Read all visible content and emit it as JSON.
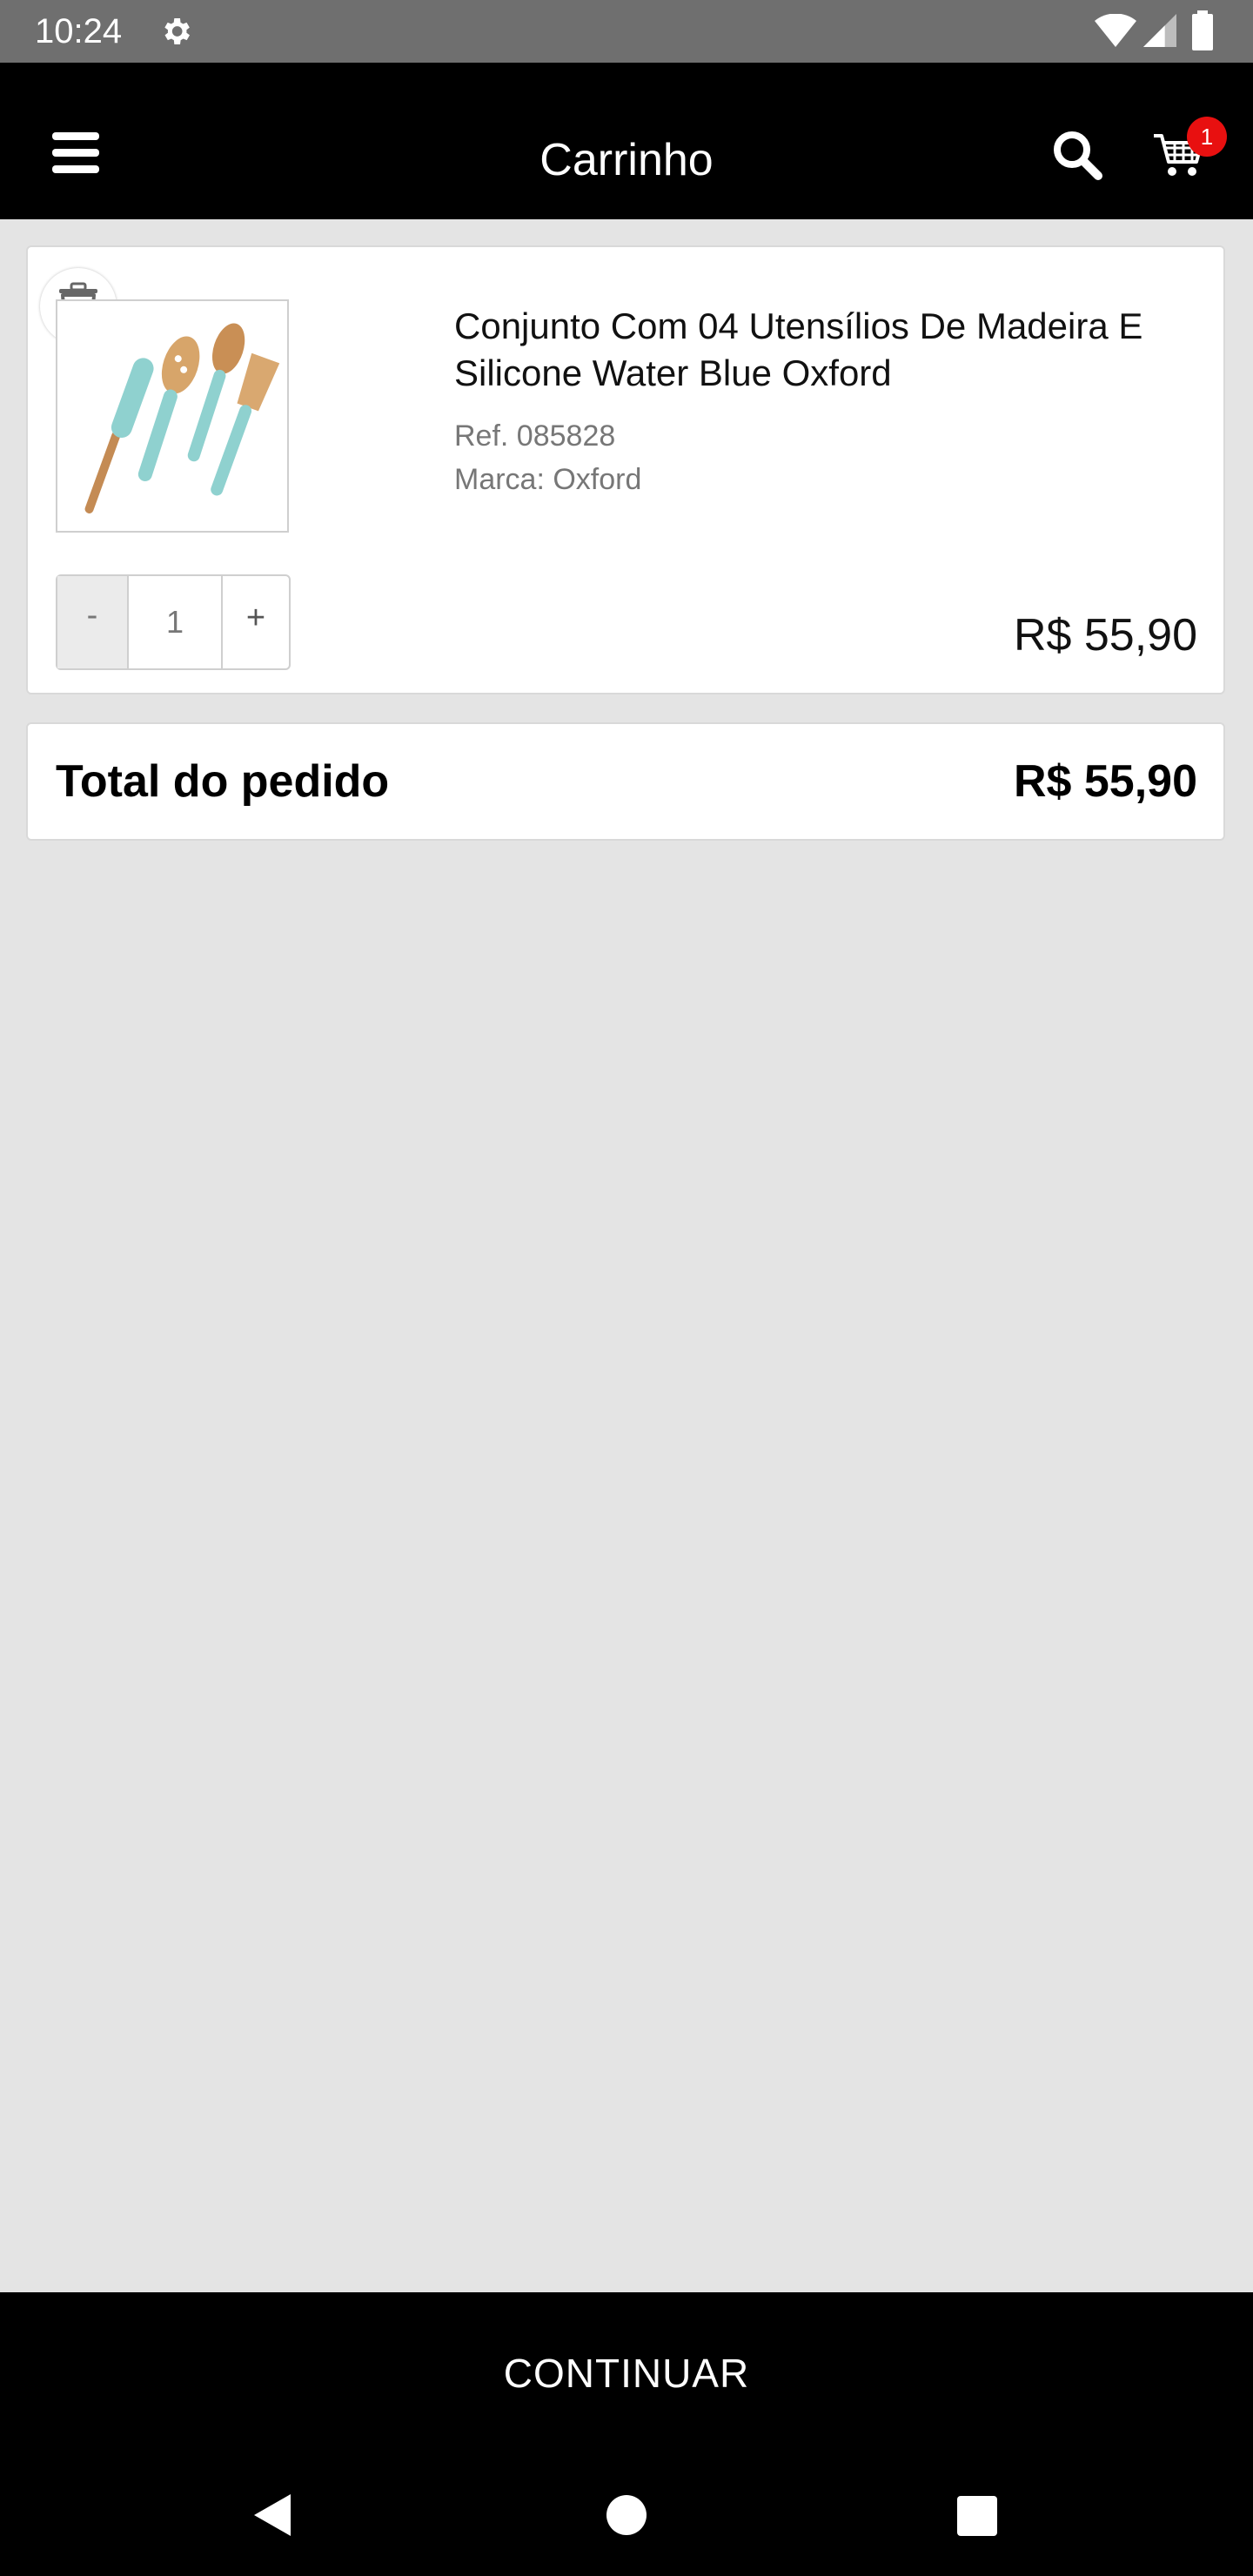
{
  "status_bar": {
    "time": "10:24"
  },
  "app_bar": {
    "title": "Carrinho",
    "cart_count": "1"
  },
  "cart_item": {
    "name": "Conjunto Com 04 Utensílios De Madeira E Silicone Water Blue Oxford",
    "ref": "Ref. 085828",
    "brand": "Marca: Oxford",
    "quantity": "1",
    "decrement_label": "-",
    "increment_label": "+",
    "price": "R$ 55,90"
  },
  "order_total": {
    "label": "Total do pedido",
    "value": "R$ 55,90"
  },
  "continue_button": {
    "label": "CONTINUAR"
  },
  "colors": {
    "app_bar_bg": "#000000",
    "page_bg": "#e4e4e4",
    "badge": "#e81010",
    "status_bar_bg": "#6f6f6f"
  }
}
